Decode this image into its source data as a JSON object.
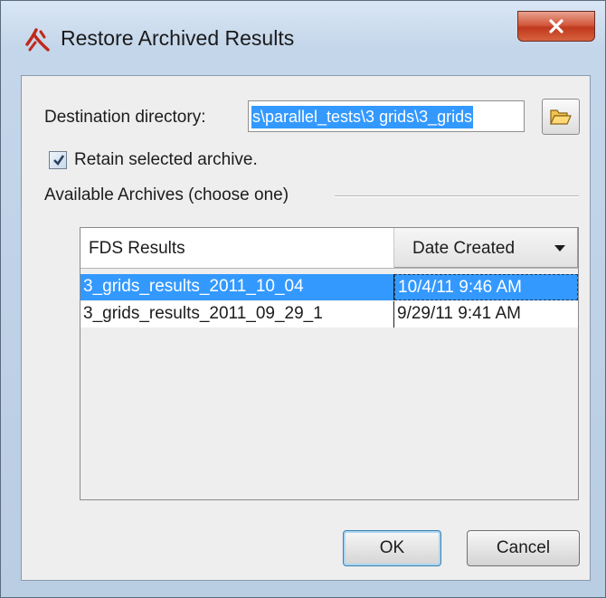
{
  "window": {
    "title": "Restore Archived Results",
    "close_glyph": "x"
  },
  "form": {
    "destination_label": "Destination directory:",
    "destination_value": "s\\parallel_tests\\3 grids\\3_grids",
    "browse_icon": "folder-open-icon",
    "retain_checked": true,
    "retain_label": "Retain selected archive.",
    "archives_group_label": "Available Archives (choose one)"
  },
  "table": {
    "columns": [
      "FDS Results",
      "Date Created"
    ],
    "sort_column": "Date Created",
    "sort_direction": "descending",
    "rows": [
      {
        "name": "3_grids_results_2011_10_04",
        "date": "10/4/11 9:46 AM",
        "selected": true
      },
      {
        "name": "3_grids_results_2011_09_29_1",
        "date": "9/29/11 9:41 AM",
        "selected": false
      }
    ]
  },
  "buttons": {
    "ok_label": "OK",
    "cancel_label": "Cancel"
  },
  "colors": {
    "selection": "#3399ff",
    "close_button": "#c0391e",
    "app_icon": "#c0281b"
  }
}
